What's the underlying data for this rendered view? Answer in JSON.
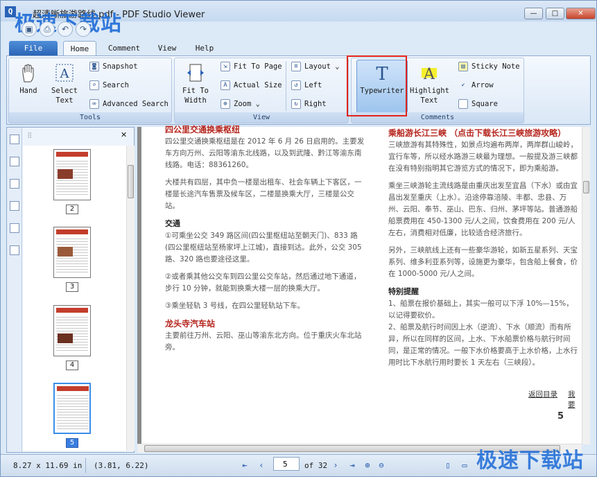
{
  "window": {
    "title": "超清晰旅游路线.pdf - PDF Studio Viewer",
    "app_icon": "Q",
    "watermark": "极速下载站",
    "min_glyph": "—",
    "max_glyph": "□",
    "close_glyph": "✕"
  },
  "quick_access": [
    "save-icon",
    "print-icon",
    "undo-icon",
    "redo-icon"
  ],
  "tabs": {
    "file": "File",
    "home": "Home",
    "comment": "Comment",
    "view": "View",
    "help": "Help"
  },
  "ribbon": {
    "tools": {
      "label": "Tools",
      "hand": "Hand",
      "select_1": "Select",
      "select_2": "Text",
      "snapshot": "Snapshot",
      "search": "Search",
      "advanced_search": "Advanced Search"
    },
    "view": {
      "label": "View",
      "fit_width_1": "Fit To",
      "fit_width_2": "Width",
      "fit_page": "Fit To Page",
      "actual_size": "Actual Size",
      "zoom": "Zoom",
      "layout": "Layout",
      "left": "Left",
      "right": "Right"
    },
    "comments": {
      "label": "Comments",
      "typewriter": "Typewriter",
      "highlight_1": "Highlight",
      "highlight_2": "Text",
      "sticky_note": "Sticky Note",
      "arrow": "Arrow",
      "square": "Square"
    }
  },
  "sidebar": {
    "close_glyph": "✕",
    "thumbnails": [
      {
        "label": "2"
      },
      {
        "label": "3"
      },
      {
        "label": "4"
      },
      {
        "label": "5",
        "selected": true
      }
    ]
  },
  "document": {
    "left": {
      "heading1": "四公里交通换乘枢纽",
      "p1": "四公里交通换乘枢纽是在 2012 年 6 月 26 日启用的。主要发车方向万州、云阳等渝东北线路，以及到武隆、黔江等渝东南线路。电话：88361260。",
      "p2": "大楼共有四层，其中负一楼是出租车、社会车辆上下客区，一楼是长途汽车售票及候车区，二楼是换乘大厅，三楼是公交站。",
      "heading2": "交通",
      "p3": "①可乘坐公交 349 路区间(四公里枢纽站至朝天门)、833 路(四公里枢纽站至杨家坪上江城)，直接到达。此外，公交 305 路、320 路也要途径这里。",
      "p4": "②或者乘其他公交车到四公里公交车站，然后通过地下通道，步行 10 分钟，就能到换乘大楼一层的换乘大厅。",
      "p5": "③乘坐轻轨 3 号线，在四公里轻轨站下车。",
      "heading3": "龙头寺汽车站",
      "p6": "主要前往万州、云阳、巫山等渝东北方向。位于重庆火车北站旁。"
    },
    "right": {
      "heading1": "乘船游长江三峡 （点击下载长江三峡旅游攻略）",
      "p1": "三峡旅游有其特殊性，如景点均遍布两岸，两岸群山峻岭，宜行车等，所以经水路游三峡最为理想。一般提及游三峡都在没有特别指明其它游览方式的情况下，即为乘船游。",
      "p2": "乘坐三峡游轮主流线路是由重庆出发至宜昌（下水）或由宜昌出发至重庆（上水）。沿途停靠涪陵、丰都、忠县、万州、云阳、奉节、巫山、巴东、归州、茅坪等站。普通游船船票费用在 450-1300 元/人之间，饮食费用在 200 元/人左右，消费相对低廉，比较适合经济旅行。",
      "p3": "另外，三峡航线上还有一些豪华游轮，如新五星系列、天宝系列、维多利亚系列等，设施更为豪华，包含船上餐食，价在 1000-5000 元/人之间。",
      "heading2": "特别提醒",
      "p4": "1、船票在报价基础上，其实一般可以下浮  10%—15%，以记得要砍价。",
      "p5": "2、船票及航行时间因上水（逆流）、下水（顺流）而有所异，所以在同样的区间，上水、下水船票价格与航行时间同，是正常的情况。一般下水价格要高于上水价格，上水行用时比下水航行用时要长 1 天左右（三峡段）。",
      "link1": "返回目录",
      "link2": "我要",
      "page_number": "5"
    }
  },
  "status": {
    "page_size": "8.27 x 11.69 in",
    "coords": "(3.81, 6.22)",
    "current_page": "5",
    "of_pages": "of 32"
  }
}
